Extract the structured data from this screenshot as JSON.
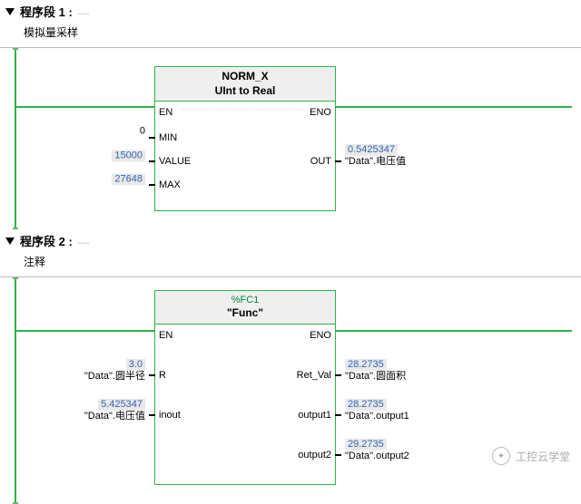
{
  "network1": {
    "header": "程序段 1 :",
    "comment": "模拟量采样",
    "block": {
      "title": "NORM_X",
      "subtitle": "UInt to Real",
      "pins": {
        "en": "EN",
        "eno": "ENO",
        "min": "MIN",
        "value": "VALUE",
        "max": "MAX",
        "out": "OUT"
      },
      "inputs": {
        "min": {
          "val": "0",
          "tag": ""
        },
        "value": {
          "val": "15000",
          "tag": ""
        },
        "max": {
          "val": "27648",
          "tag": ""
        }
      },
      "outputs": {
        "out": {
          "val": "0.5425347",
          "tag": "\"Data\".电压值"
        }
      }
    },
    "trail": "....."
  },
  "network2": {
    "header": "程序段 2 :",
    "comment": "注释",
    "block": {
      "fc": "%FC1",
      "title": "\"Func\"",
      "pins": {
        "en": "EN",
        "eno": "ENO",
        "r": "R",
        "inout": "inout",
        "retval": "Ret_Val",
        "out1": "output1",
        "out2": "output2"
      },
      "inputs": {
        "r": {
          "val": "3.0",
          "tag": "\"Data\".圆半径"
        },
        "inout": {
          "val": "5.425347",
          "tag": "\"Data\".电压值"
        }
      },
      "outputs": {
        "retval": {
          "val": "28.2735",
          "tag": "\"Data\".圆面积"
        },
        "out1": {
          "val": "28.2735",
          "tag": "\"Data\".output1"
        },
        "out2": {
          "val": "29.2735",
          "tag": "\"Data\".output2"
        }
      }
    },
    "trail": "....."
  },
  "watermark": "工控云学堂"
}
